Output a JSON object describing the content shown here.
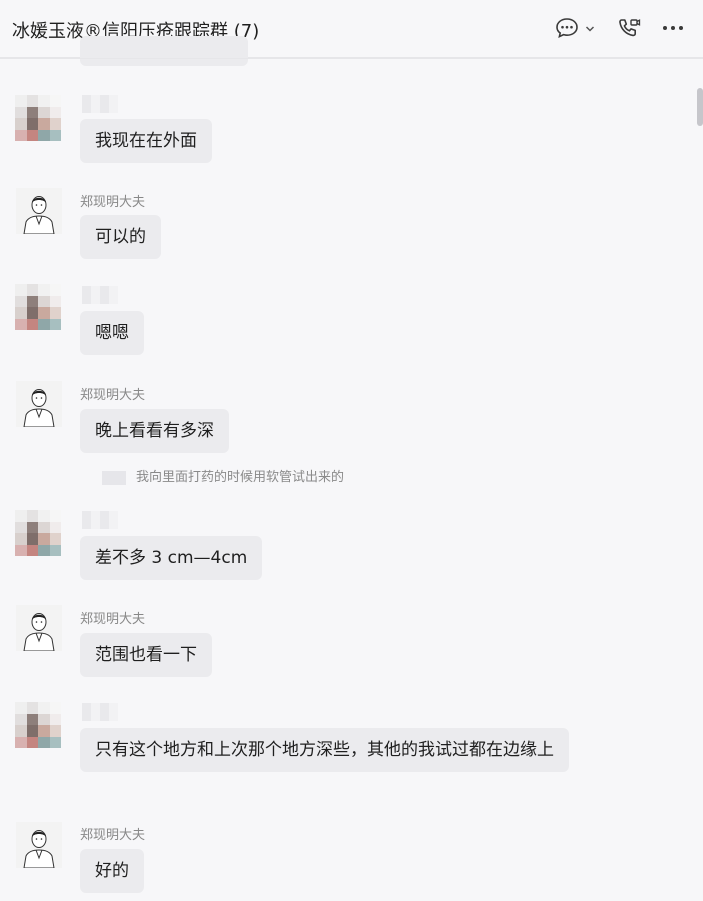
{
  "header": {
    "title": "冰媛玉液®信阳压疮跟踪群 (7)",
    "icons": [
      "chat-bubble-icon",
      "chevron-down-icon",
      "video-call-icon",
      "more-icon"
    ]
  },
  "participants": {
    "doctor_name": "郑现明大夫"
  },
  "messages": [
    {
      "sender": "member",
      "text": "我现在在外面"
    },
    {
      "sender": "doctor",
      "text": "可以的"
    },
    {
      "sender": "member",
      "text": "嗯嗯"
    },
    {
      "sender": "doctor",
      "text": "晚上看看有多深"
    },
    {
      "sender": "quote",
      "text": "我向里面打药的时候用软管试出来的"
    },
    {
      "sender": "member",
      "text": "差不多 3 cm—4cm"
    },
    {
      "sender": "doctor",
      "text": "范围也看一下"
    },
    {
      "sender": "member",
      "text": "只有这个地方和上次那个地方深些，其他的我试过都在边缘上"
    },
    {
      "sender": "doctor",
      "text": "好的"
    }
  ],
  "colors": {
    "background": "#f7f7f9",
    "bubble": "#ebebee",
    "name_text": "#888888"
  }
}
